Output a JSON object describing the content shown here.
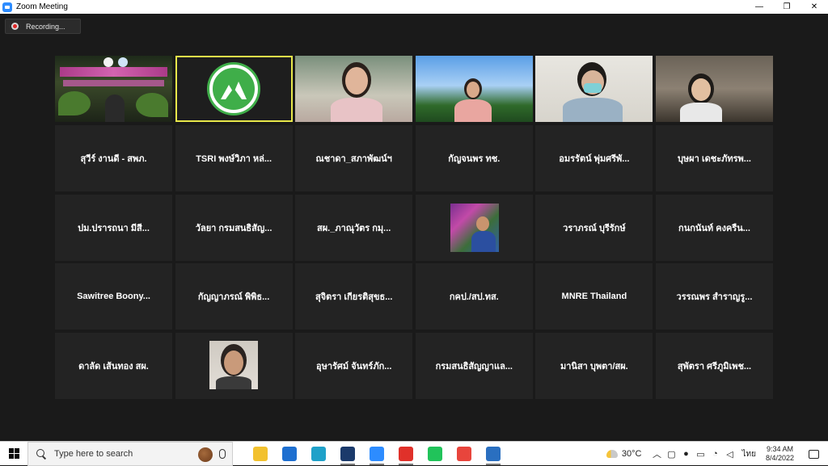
{
  "window": {
    "title": "Zoom Meeting",
    "minimize": "—",
    "maximize": "❐",
    "close": "✕"
  },
  "recording": {
    "label": "Recording..."
  },
  "participants": [
    {
      "type": "video",
      "name": ""
    },
    {
      "type": "logo",
      "name": "",
      "active": true
    },
    {
      "type": "video",
      "name": ""
    },
    {
      "type": "video",
      "name": ""
    },
    {
      "type": "video",
      "name": ""
    },
    {
      "type": "video",
      "name": ""
    },
    {
      "type": "name",
      "name": "สุวีร์ งานดี - สพภ."
    },
    {
      "type": "name",
      "name": "TSRI พงษ์วิภา หล่..."
    },
    {
      "type": "name",
      "name": "ณชาดา_สภาพัฒน์ฯ"
    },
    {
      "type": "name",
      "name": "กัญจนพร ทช."
    },
    {
      "type": "name",
      "name": "อมรรัตน์ พุ่มศรีพั..."
    },
    {
      "type": "name",
      "name": "บุษผา เดชะภัทรพ..."
    },
    {
      "type": "name",
      "name": "ปม.ปรารถนา มีสี..."
    },
    {
      "type": "name",
      "name": "วัลยา กรมสนธิสัญ..."
    },
    {
      "type": "name",
      "name": "สผ._ภาณุวัตร กมุ..."
    },
    {
      "type": "photo-orchid",
      "name": ""
    },
    {
      "type": "name",
      "name": "วราภรณ์ บุรีรักษ์"
    },
    {
      "type": "name",
      "name": "กนกนันท์ คงครืน..."
    },
    {
      "type": "name",
      "name": "Sawitree  Boony..."
    },
    {
      "type": "name",
      "name": "กัญญาภรณ์ พิพิธ..."
    },
    {
      "type": "name",
      "name": "สุจิตรา เกียรติสุขธ..."
    },
    {
      "type": "name",
      "name": "กคป./สป.ทส."
    },
    {
      "type": "name",
      "name": "MNRE Thailand"
    },
    {
      "type": "name",
      "name": "วรรณพร สำราญรู..."
    },
    {
      "type": "name",
      "name": "ดาลัด เส้นทอง สผ."
    },
    {
      "type": "photo-face",
      "name": ""
    },
    {
      "type": "name",
      "name": "อุษารัศม์ จันทร์ภัก..."
    },
    {
      "type": "name",
      "name": "กรมสนธิสัญญาแล..."
    },
    {
      "type": "name",
      "name": "มานิสา บุพตา/สผ."
    },
    {
      "type": "name",
      "name": "สุพัตรา ศรีภูมิเพช..."
    }
  ],
  "taskbar": {
    "search_placeholder": "Type here to search",
    "apps": [
      {
        "name": "file-explorer-icon",
        "color": "#f2c12e",
        "running": false
      },
      {
        "name": "mail-icon",
        "color": "#1e6fd0",
        "running": false
      },
      {
        "name": "edge-icon",
        "color": "#1fa1c9",
        "running": false
      },
      {
        "name": "webex-icon",
        "color": "#1b3a6b",
        "running": true
      },
      {
        "name": "zoom-icon",
        "color": "#2d8cff",
        "running": true
      },
      {
        "name": "acrobat-icon",
        "color": "#e0312a",
        "running": true
      },
      {
        "name": "line-icon",
        "color": "#21c35a",
        "running": false
      },
      {
        "name": "chrome-icon",
        "color": "#e8453c",
        "running": false
      },
      {
        "name": "photos-icon",
        "color": "#2a6fc0",
        "running": true
      }
    ],
    "weather": "30°C",
    "language": "ไทย",
    "time": "9:34 AM",
    "date": "8/4/2022"
  }
}
